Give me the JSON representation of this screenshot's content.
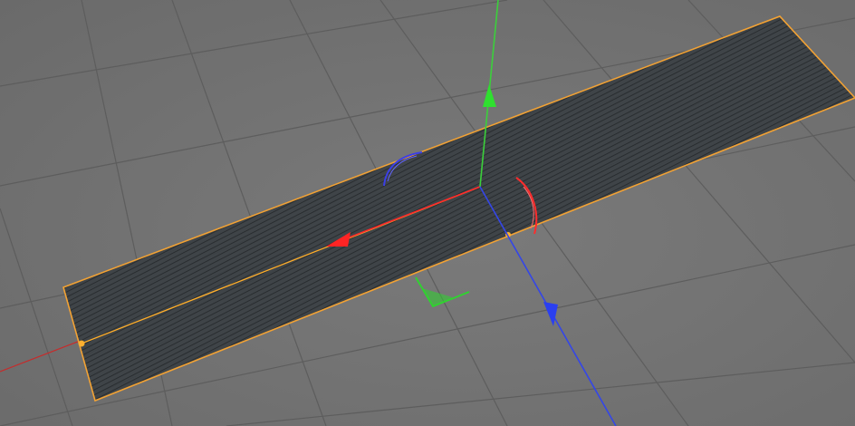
{
  "viewport": {
    "type": "3D perspective viewport",
    "background_color": "#737373",
    "grid_color": "#5e5e5e"
  },
  "object": {
    "kind": "plane",
    "selected": true,
    "selection_outline_color": "#f0a030",
    "mesh_fill_color": "#3e4347",
    "wire_color": "#262a2d"
  },
  "gizmo": {
    "x_axis_color": "#e02020",
    "y_axis_color": "#22d022",
    "z_axis_color": "#2b3fe0",
    "x_rotation_color": "#ff3030",
    "y_rotation_color": "#30d030",
    "z_rotation_color": "#3040ff",
    "icons": [
      "x-axis-arrow-icon",
      "y-axis-arrow-icon",
      "z-axis-arrow-icon"
    ]
  }
}
